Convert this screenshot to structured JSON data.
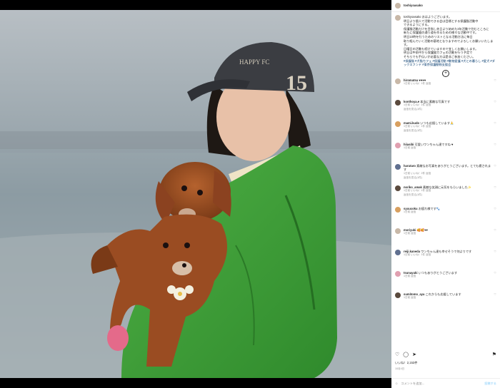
{
  "post": {
    "username": "toshiyoasako",
    "caption_lines": [
      "toshiyoasako おはようございます。",
      "明日より個人で活動できる会は目標とする保護猫活動中",
      "できるようにする。",
      "保護猫活動だけを目指し先日より始めた3年活動で住むところに",
      "新たに保護猫の通り道を作るための様々な活動中です。",
      "明日10時を行うためのリストとなる活動方法に毎日",
      "取り組んでいく活動の基地となりますのでよろしくお願いいたします。",
      "日曜日の活動も続けていますので宜しくお願いします。",
      "明日は午前中から保護猫カフェの活動を行う予定で",
      "そちらでも手伝いが必要な方は是非ご参加ください。"
    ],
    "hashtags": "#保護猫 #犬猫カフェ #保護活動 #動物愛護 #犬との暮らし #愛犬 #ダックスフンド #東京保護動物支援会",
    "comments": [
      {
        "user": "hiromatsu",
        "text": "♥♥♥♥",
        "meta": "1日前 いいね！1件 返信",
        "replies": "",
        "av": ""
      },
      {
        "user": "konthoya.e",
        "text": "本当に素敵な写真です",
        "meta": "1日前 いいね！1件 返信",
        "replies": "返信を見る(1件)",
        "av": "d"
      },
      {
        "user": "mami.kudo",
        "text": "いつも応援しています🙏",
        "meta": "1日前 いいね！1件 返信",
        "replies": "返信を見る(1件)",
        "av": "g"
      },
      {
        "user": "hiiasibi",
        "text": "可愛いワンちゃん達ですね ♥",
        "meta": "1日前 返信",
        "replies": "",
        "av": "p"
      },
      {
        "user": "harutaro",
        "text": "素敵なお写真をありがとうございます。とても癒されます",
        "meta": "1日前 いいね！2件 返信",
        "replies": "返信を見る(1件)",
        "av": "b"
      },
      {
        "user": "noriko_amak",
        "text": "素敵な笑顔に元気をもらいました✨",
        "meta": "1日前 いいね！1件 返信",
        "replies": "返信を見る(1件)",
        "av": "d"
      },
      {
        "user": "syuucoku",
        "text": "お疲れ様です🐾",
        "meta": "1日前 返信",
        "replies": "",
        "av": "g"
      },
      {
        "user": "moriyuki",
        "text": "🥰🥰♥♥",
        "meta": "1日前 返信",
        "replies": "",
        "av": ""
      },
      {
        "user": "reiji.kaneda",
        "text": "ワンちゃん達も幸せそうで何よりです",
        "meta": "1日前 いいね！1件 返信",
        "replies": "",
        "av": "b"
      },
      {
        "user": "tsunayuki",
        "text": "いつもありがとうございます",
        "meta": "1日前 返信",
        "replies": "",
        "av": "p"
      },
      {
        "user": "sumitomo_aya",
        "text": "これからも応援しています",
        "meta": "1日前 返信",
        "replies": "",
        "av": "d"
      }
    ],
    "likes": "いいね！2,153件",
    "date": "10月4日",
    "add_comment_placeholder": "コメントを追加...",
    "post_label": "投稿する"
  }
}
